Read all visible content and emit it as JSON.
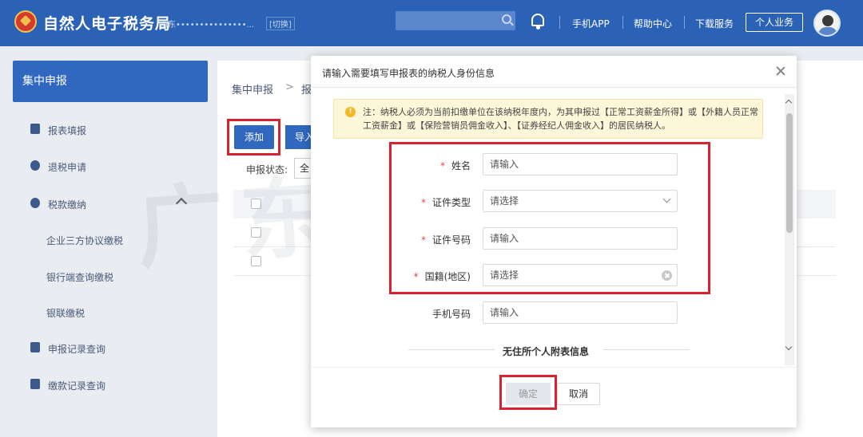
{
  "header": {
    "app_title": "自然人电子税务局",
    "region": "山东•••••••••••••••...",
    "switch_label": "[切换]",
    "nav_mobile": "手机APP",
    "nav_help": "帮助中心",
    "nav_download": "下载服务",
    "personal_button": "个人业务"
  },
  "sidebar": {
    "title": "集中申报",
    "items": [
      {
        "label": "报表填报",
        "icon": "form-icon"
      },
      {
        "label": "退税申请",
        "icon": "refund-icon"
      },
      {
        "label": "税款缴纳",
        "icon": "payment-icon"
      }
    ],
    "sub_items": [
      "企业三方协议缴税",
      "银行端查询缴税",
      "银联缴税"
    ],
    "items_bottom": [
      {
        "label": "申报记录查询",
        "icon": "search-record-icon"
      },
      {
        "label": "缴款记录查询",
        "icon": "record-icon"
      }
    ]
  },
  "main": {
    "breadcrumb_1": "集中申报",
    "breadcrumb_sep": ">",
    "breadcrumb_2": "报",
    "add_button": "添加",
    "import_button": "导入",
    "status_label": "申报状态:",
    "status_value": "全"
  },
  "watermark": "广东税务",
  "modal": {
    "title": "请输入需要填写申报表的纳税人身份信息",
    "notice": "注：纳税人必须为当前扣缴单位在该纳税年度内，为其申报过【正常工资薪金所得】或【外籍人员正常工资薪金】或【保险营销员佣金收入】、【证券经纪人佣金收入】的居民纳税人。",
    "fields": [
      {
        "label": "姓名",
        "required": "*",
        "placeholder": "请输入"
      },
      {
        "label": "证件类型",
        "required": "*",
        "placeholder": "请选择"
      },
      {
        "label": "证件号码",
        "required": "*",
        "placeholder": "请输入"
      },
      {
        "label": "国籍(地区)",
        "required": "*",
        "placeholder": "请选择"
      },
      {
        "label": "手机号码",
        "required": "",
        "placeholder": "请输入"
      }
    ],
    "section_title": "无住所个人附表信息",
    "confirm_button": "确定",
    "cancel_button": "取消"
  },
  "colors": {
    "header_bg": "#2c62b6",
    "highlight_red": "#d6232f",
    "notice_bg": "#fdf6d8"
  }
}
